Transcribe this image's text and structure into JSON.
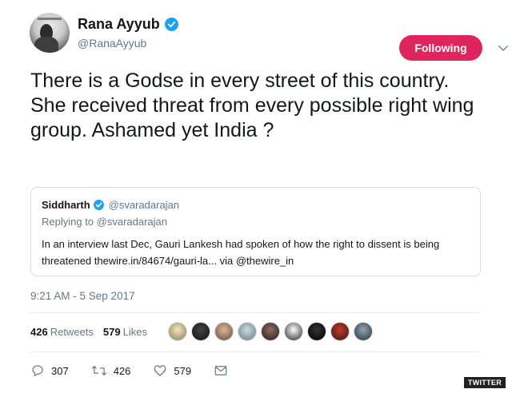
{
  "author": {
    "name": "Rana Ayyub",
    "handle": "@RanaAyyub",
    "avatar_icon": "profile-photo"
  },
  "follow_button": {
    "label": "Following",
    "color": "#e0245e"
  },
  "tweet": {
    "text": "There is a Godse in every street of this country. She received threat from every possible right wing group. Ashamed yet India ?"
  },
  "quoted_tweet": {
    "name": "Siddharth",
    "handle": "@svaradarajan",
    "replying_to": "Replying to @svaradarajan",
    "text": "In an interview last Dec, Gauri Lankesh had spoken of how the right to dissent is being threatened thewire.in/84674/gauri-la... via @thewire_in"
  },
  "timestamp": "9:21 AM - 5 Sep 2017",
  "stats": {
    "retweets_count": "426",
    "retweets_label": "Retweets",
    "likes_count": "579",
    "likes_label": "Likes"
  },
  "actions": {
    "replies": "307",
    "retweets": "426",
    "likes": "579"
  },
  "accent_color": "#1da1f2",
  "watermark": "TWITTER"
}
